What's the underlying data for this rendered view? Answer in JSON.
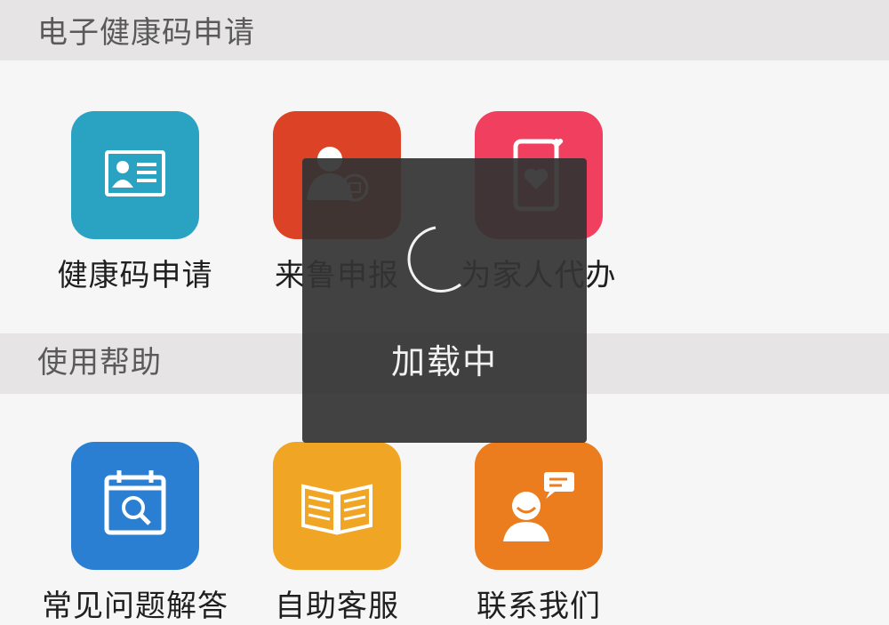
{
  "sections": [
    {
      "title": "电子健康码申请",
      "items": [
        {
          "label": "健康码申请",
          "icon": "id-card-icon",
          "color": "#2aa3c3"
        },
        {
          "label": "来鲁申报",
          "icon": "person-report-icon",
          "color": "#dc4326"
        },
        {
          "label": "为家人代办",
          "icon": "phone-heart-icon",
          "color": "#f03f5f"
        }
      ]
    },
    {
      "title": "使用帮助",
      "items": [
        {
          "label": "常见问题解答",
          "icon": "calendar-search-icon",
          "color": "#2a7fd3"
        },
        {
          "label": "自助客服",
          "icon": "book-icon",
          "color": "#f0a624"
        },
        {
          "label": "联系我们",
          "icon": "chat-person-icon",
          "color": "#eb7d1e"
        }
      ]
    }
  ],
  "loading": {
    "text": "加载中",
    "icon": "spinner-icon"
  }
}
